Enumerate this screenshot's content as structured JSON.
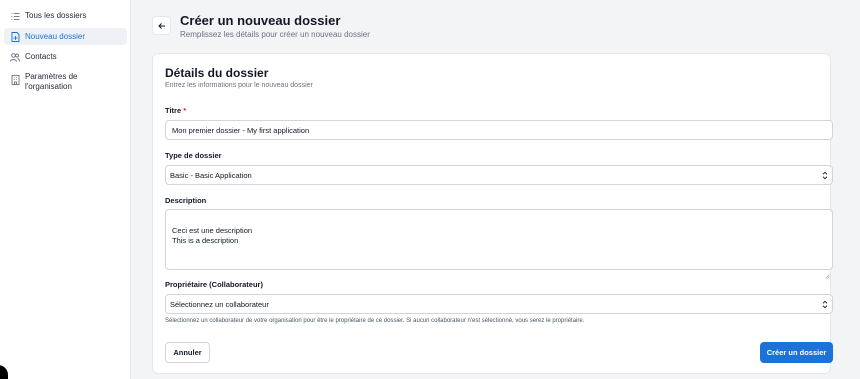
{
  "sidebar": {
    "items": [
      {
        "label": "Tous les dossiers",
        "icon": "list-icon",
        "active": false
      },
      {
        "label": "Nouveau dossier",
        "icon": "file-plus-icon",
        "active": true
      },
      {
        "label": "Contacts",
        "icon": "users-icon",
        "active": false
      },
      {
        "label": "Paramètres de l'organisation",
        "icon": "building-icon",
        "active": false
      }
    ]
  },
  "header": {
    "back_icon": "arrow-left-icon",
    "title": "Créer un nouveau dossier",
    "subtitle": "Remplissez les détails pour créer un nouveau dossier"
  },
  "form": {
    "title": "Détails du dossier",
    "subtitle": "Entrez les informations pour le nouveau dossier",
    "title_field": {
      "label": "Titre",
      "required_mark": "*",
      "value": "Mon premier dossier - My first application"
    },
    "type_field": {
      "label": "Type de dossier",
      "value": "Basic - Basic Application"
    },
    "description_field": {
      "label": "Description",
      "value": "Ceci est une description\nThis is a description"
    },
    "owner_field": {
      "label": "Propriétaire (Collaborateur)",
      "value": "Sélectionnez un collaborateur",
      "help": "Sélectionnez un collaborateur de votre organisation pour être le propriétaire de ce dossier. Si aucun collaborateur n'est sélectionné, vous serez le propriétaire."
    },
    "cancel_label": "Annuler",
    "submit_label": "Créer un dossier"
  },
  "colors": {
    "accent": "#1d72d8",
    "active_nav_bg": "#eef2f7",
    "background": "#f3f4f6"
  }
}
